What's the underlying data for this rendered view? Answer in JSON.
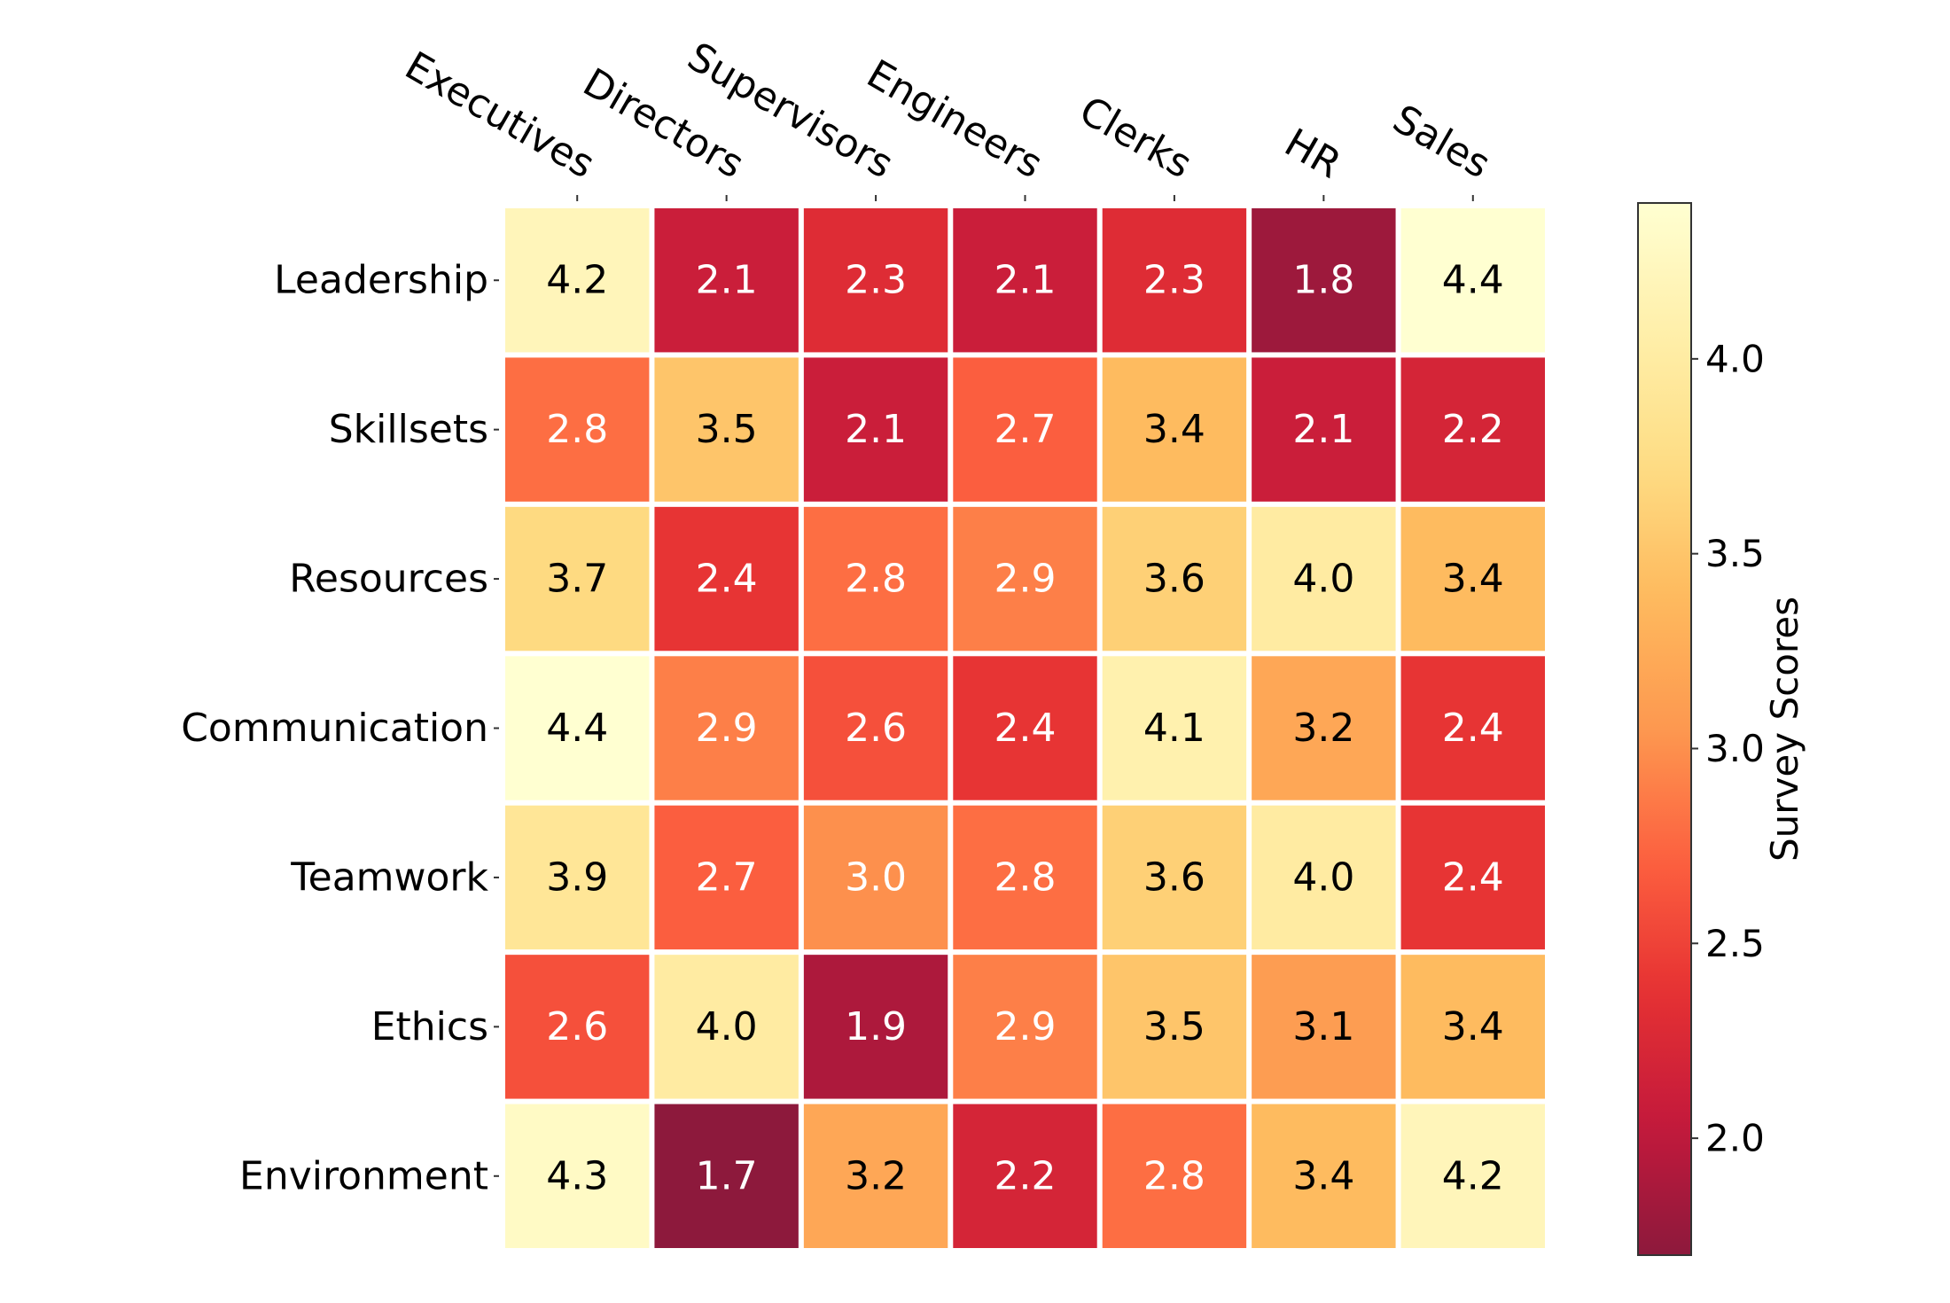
{
  "chart_data": {
    "type": "heatmap",
    "title": "",
    "xlabel": "",
    "ylabel": "",
    "x_categories": [
      "Executives",
      "Directors",
      "Supervisors",
      "Engineers",
      "Clerks",
      "HR",
      "Sales"
    ],
    "y_categories": [
      "Leadership",
      "Skillsets",
      "Resources",
      "Communication",
      "Teamwork",
      "Ethics",
      "Environment"
    ],
    "values": [
      [
        4.2,
        2.1,
        2.3,
        2.1,
        2.3,
        1.8,
        4.4
      ],
      [
        2.8,
        3.5,
        2.1,
        2.7,
        3.4,
        2.1,
        2.2
      ],
      [
        3.7,
        2.4,
        2.8,
        2.9,
        3.6,
        4.0,
        3.4
      ],
      [
        4.4,
        2.9,
        2.6,
        2.4,
        4.1,
        3.2,
        2.4
      ],
      [
        3.9,
        2.7,
        3.0,
        2.8,
        3.6,
        4.0,
        2.4
      ],
      [
        2.6,
        4.0,
        1.9,
        2.9,
        3.5,
        3.1,
        3.4
      ],
      [
        4.3,
        1.7,
        3.2,
        2.2,
        2.8,
        3.4,
        4.2
      ]
    ],
    "annotations": true,
    "value_format": "0.1f",
    "colormap": "YlOrRd_r",
    "colormap_stops": [
      "#ffffcc",
      "#ffeda0",
      "#fed976",
      "#feb24c",
      "#fd8d3c",
      "#fc4e2a",
      "#e31a1c",
      "#bd0026",
      "#800026"
    ],
    "vmin": 1.7,
    "vmax": 4.4,
    "text_light_color": "#ffffff",
    "text_dark_color": "#000000",
    "text_light_threshold": 3.0,
    "colorbar": {
      "label": "Survey Scores",
      "ticks": [
        2.0,
        2.5,
        3.0,
        3.5,
        4.0
      ],
      "tick_labels": [
        "2.0",
        "2.5",
        "3.0",
        "3.5",
        "4.0"
      ],
      "range": [
        1.7,
        4.4
      ],
      "placement": "right"
    },
    "x_tick_position": "top",
    "x_tick_rotation_deg": 30,
    "grid": false
  }
}
